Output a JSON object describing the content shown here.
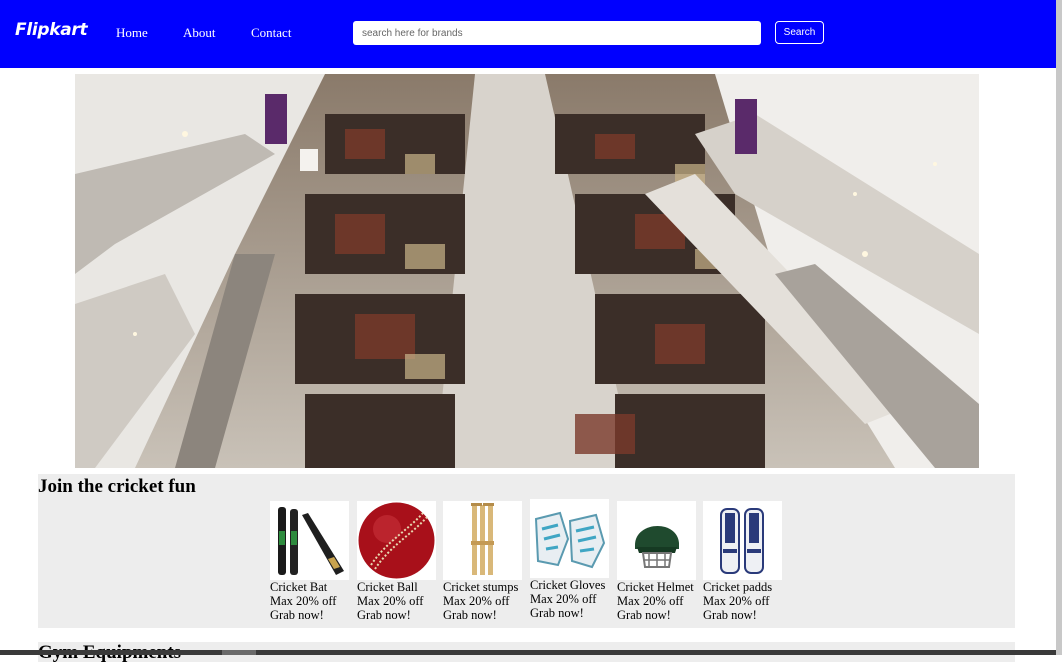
{
  "nav": {
    "brand": "Flipkart",
    "links": [
      "Home",
      "About",
      "Contact"
    ],
    "search_placeholder": "search here for brands",
    "search_button": "Search"
  },
  "hero": {
    "icon": "mall-interior-photo"
  },
  "cricket": {
    "title": "Join the cricket fun",
    "items": [
      {
        "name": "Cricket Bat",
        "offer": "Max 20% off",
        "cta": "Grab now!",
        "icon": "cricket-bat-icon"
      },
      {
        "name": "Cricket Ball",
        "offer": "Max 20% off",
        "cta": "Grab now!",
        "icon": "cricket-ball-icon"
      },
      {
        "name": "Cricket stumps",
        "offer": "Max 20% off",
        "cta": "Grab now!",
        "icon": "cricket-stumps-icon"
      },
      {
        "name": "Cricket Gloves",
        "offer": "Max 20% off",
        "cta": "Grab now!",
        "icon": "cricket-gloves-icon"
      },
      {
        "name": "Cricket Helmet",
        "offer": "Max 20% off",
        "cta": "Grab now!",
        "icon": "cricket-helmet-icon"
      },
      {
        "name": "Cricket padds",
        "offer": "Max 20% off",
        "cta": "Grab now!",
        "icon": "cricket-pads-icon"
      }
    ]
  },
  "gym": {
    "title": "Gym Equipments"
  },
  "colors": {
    "nav_bg": "#0000ff",
    "section_bg": "#ededed"
  }
}
